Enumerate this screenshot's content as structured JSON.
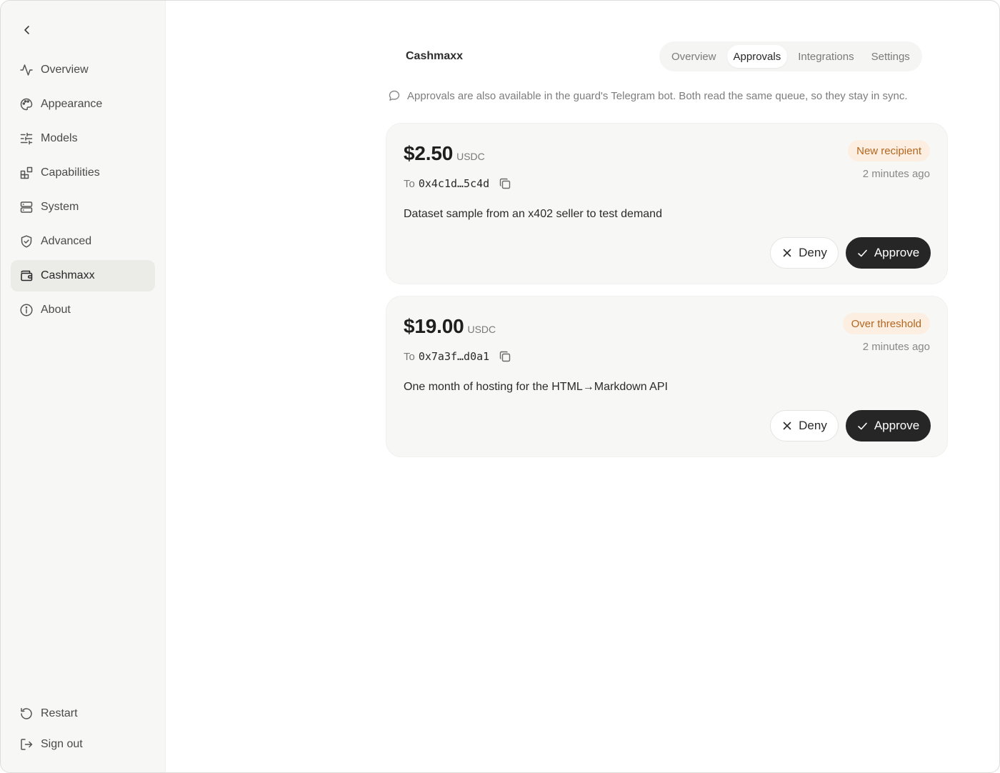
{
  "sidebar": {
    "back_icon": "chevron-left-icon",
    "items": [
      {
        "label": "Overview",
        "icon": "activity-icon"
      },
      {
        "label": "Appearance",
        "icon": "palette-icon"
      },
      {
        "label": "Models",
        "icon": "sliders-icon"
      },
      {
        "label": "Capabilities",
        "icon": "blocks-icon"
      },
      {
        "label": "System",
        "icon": "server-icon"
      },
      {
        "label": "Advanced",
        "icon": "shield-check-icon"
      },
      {
        "label": "Cashmaxx",
        "icon": "wallet-icon",
        "active": true
      },
      {
        "label": "About",
        "icon": "info-icon"
      }
    ],
    "bottom": [
      {
        "label": "Restart",
        "icon": "restart-icon"
      },
      {
        "label": "Sign out",
        "icon": "sign-out-icon"
      }
    ]
  },
  "header": {
    "title": "Cashmaxx",
    "tabs": [
      {
        "label": "Overview"
      },
      {
        "label": "Approvals",
        "active": true
      },
      {
        "label": "Integrations"
      },
      {
        "label": "Settings"
      }
    ]
  },
  "notice": {
    "text": "Approvals are also available in the guard's Telegram bot. Both read the same queue, so they stay in sync."
  },
  "approvals": [
    {
      "amount": "$2.50",
      "currency": "USDC",
      "to_label": "To",
      "address": "0x4c1d…5c4d",
      "memo": "Dataset sample from an x402 seller to test demand",
      "badge": "New recipient",
      "time": "2 minutes ago",
      "deny_label": "Deny",
      "approve_label": "Approve"
    },
    {
      "amount": "$19.00",
      "currency": "USDC",
      "to_label": "To",
      "address": "0x7a3f…d0a1",
      "memo": "One month of hosting for the HTML→Markdown API",
      "badge": "Over threshold",
      "time": "2 minutes ago",
      "deny_label": "Deny",
      "approve_label": "Approve"
    }
  ],
  "colors": {
    "accent_dark": "#262626",
    "badge_bg": "#fcefe2",
    "badge_text": "#b3661f",
    "sidebar_bg": "#f7f7f5"
  }
}
